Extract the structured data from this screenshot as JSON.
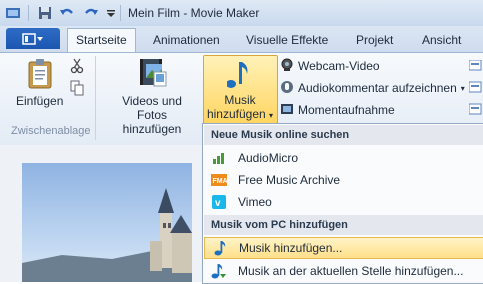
{
  "window": {
    "title": "Mein Film - Movie Maker"
  },
  "tabs": [
    "Startseite",
    "Animationen",
    "Visuelle Effekte",
    "Projekt",
    "Ansicht"
  ],
  "ribbon": {
    "paste_label": "Einfügen",
    "clipboard_group": "Zwischenablage",
    "add_videos_label": "Videos und Fotos",
    "add_videos_label2": "hinzufügen",
    "musik_label": "Musik",
    "musik_label2": "hinzufügen",
    "webcam_label": "Webcam-Video",
    "audio_comment_label": "Audiokommentar aufzeichnen",
    "snapshot_label": "Momentaufnahme"
  },
  "menu": {
    "online_header": "Neue Musik online suchen",
    "online_items": [
      "AudioMicro",
      "Free Music Archive",
      "Vimeo"
    ],
    "pc_header": "Musik vom PC hinzufügen",
    "pc_items": [
      "Musik hinzufügen...",
      "Musik an der aktuellen Stelle hinzufügen..."
    ]
  },
  "colors": {
    "accent": "#1b57b0",
    "highlight": "#ffe08a"
  }
}
